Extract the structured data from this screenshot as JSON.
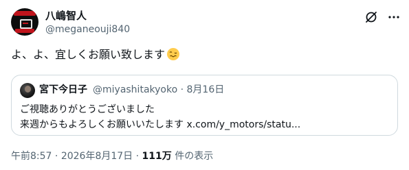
{
  "author": {
    "display_name": "八嶋智人",
    "handle": "@meganeouji840"
  },
  "icons": {
    "grok": "grok-icon",
    "more": "more-icon",
    "emoji": "woozy-face-icon"
  },
  "tweet": {
    "text": "よ、よ、宜しくお願い致します"
  },
  "quote": {
    "display_name": "宮下今日子",
    "handle": "@miyashitakyoko",
    "separator": "·",
    "date": "8月16日",
    "line1": "ご視聴ありがとうございました",
    "line2": "来週からもよろしくお願いいたします x.com/y_motors/statu..."
  },
  "meta": {
    "time": "午前8:57",
    "dot1": "·",
    "date": "2026年8月17日",
    "dot2": "·",
    "views_count": "111万",
    "views_label": "件の表示"
  },
  "colors": {
    "text": "#0f1419",
    "secondary": "#536471",
    "border": "#cfd9de",
    "avatar_red": "#c0141c"
  }
}
